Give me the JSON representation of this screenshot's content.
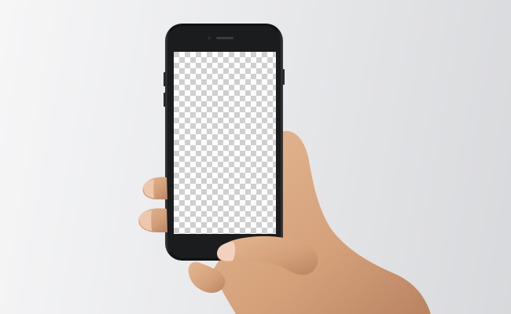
{
  "scene": {
    "background_colors": [
      "#f6f6f7",
      "#d8d9dc"
    ],
    "phone_color": "#1b1c1e",
    "screen_pattern": "transparency-checkerboard",
    "checker_colors": [
      "#ffffff",
      "#cfcfcf"
    ],
    "skin_color": "#d9a882"
  }
}
